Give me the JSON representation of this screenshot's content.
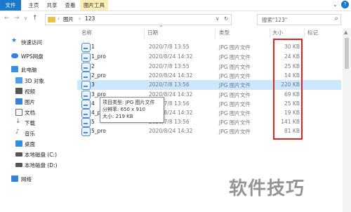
{
  "ribbon": {
    "tabs": [
      "文件",
      "主页",
      "共享",
      "查看",
      "图片工具"
    ]
  },
  "address": {
    "crumbs": [
      "图片",
      "123"
    ],
    "sep": "›"
  },
  "search": {
    "placeholder": "搜索\"123\""
  },
  "sidebar": {
    "items": [
      {
        "label": "快速访问",
        "icon": "star-icon",
        "color": "#2b7fd4"
      },
      {
        "label": "WPS网盘",
        "icon": "cloud-icon",
        "color": "#3a7fd8"
      },
      {
        "label": "此电脑",
        "icon": "computer-icon",
        "color": "#3a8ee0"
      },
      {
        "label": "3D 对象",
        "icon": "cube-icon",
        "color": "#4aa0e8"
      },
      {
        "label": "视频",
        "icon": "video-icon",
        "color": "#555555"
      },
      {
        "label": "图片",
        "icon": "picture-icon",
        "color": "#3a7fd8"
      },
      {
        "label": "文档",
        "icon": "document-icon",
        "color": "#666666"
      },
      {
        "label": "下载",
        "icon": "download-icon",
        "color": "#2b7fd4"
      },
      {
        "label": "音乐",
        "icon": "music-icon",
        "color": "#2b7fd4"
      },
      {
        "label": "桌面",
        "icon": "desktop-icon",
        "color": "#2f8fe0"
      },
      {
        "label": "本地磁盘 (C:)",
        "icon": "drive-icon",
        "color": "#555555"
      },
      {
        "label": "本地磁盘 (D:)",
        "icon": "drive-icon",
        "color": "#555555"
      },
      {
        "label": "网络",
        "icon": "network-icon",
        "color": "#3a7fd8"
      }
    ]
  },
  "columns": {
    "name": "名称",
    "date": "日期",
    "type": "类型",
    "size": "大小",
    "tags": "标记"
  },
  "files": [
    {
      "name": "1",
      "date": "2020/7/8 13:55",
      "type": "JPG 图片文件",
      "size": "30 KB"
    },
    {
      "name": "1_pro",
      "date": "2020/8/24 14:32",
      "type": "JPG 图片文件",
      "size": "24 KB"
    },
    {
      "name": "2",
      "date": "2020/7/8 13:55",
      "type": "JPG 图片文件",
      "size": "25 KB"
    },
    {
      "name": "2_pro",
      "date": "2020/8/24 14:32",
      "type": "JPG 图片文件",
      "size": "14 KB"
    },
    {
      "name": "3",
      "date": "2020/7/8 13:56",
      "type": "JPG 图片文件",
      "size": "220 KB"
    },
    {
      "name": "3_pro",
      "date": "2020/8/24 14:32",
      "type": "JPG 图片文件",
      "size": "69 KB"
    },
    {
      "name": "4",
      "date": "2020/7/8 13:56",
      "type": "JPG 图片文件",
      "size": "25 KB"
    },
    {
      "name": "4_pro",
      "date": "2020/8/24 14:32",
      "type": "JPG 图片文件",
      "size": "19 KB"
    },
    {
      "name": "5",
      "date": "2020/7/8 13:56",
      "type": "JPG 图片文件",
      "size": "141 KB"
    },
    {
      "name": "5_pro",
      "date": "2020/8/24 14:32",
      "type": "JPG 图片文件",
      "size": "81 KB"
    }
  ],
  "tooltip": {
    "line1": "项目类型: JPG 图片文件",
    "line2": "分辨率: 650 x 910",
    "line3": "大小: 219 KB"
  },
  "watermark": "软件技巧",
  "colors": {
    "accent": "#1979ca",
    "selection": "#cce8ff",
    "highlight_box": "#e0231d"
  }
}
